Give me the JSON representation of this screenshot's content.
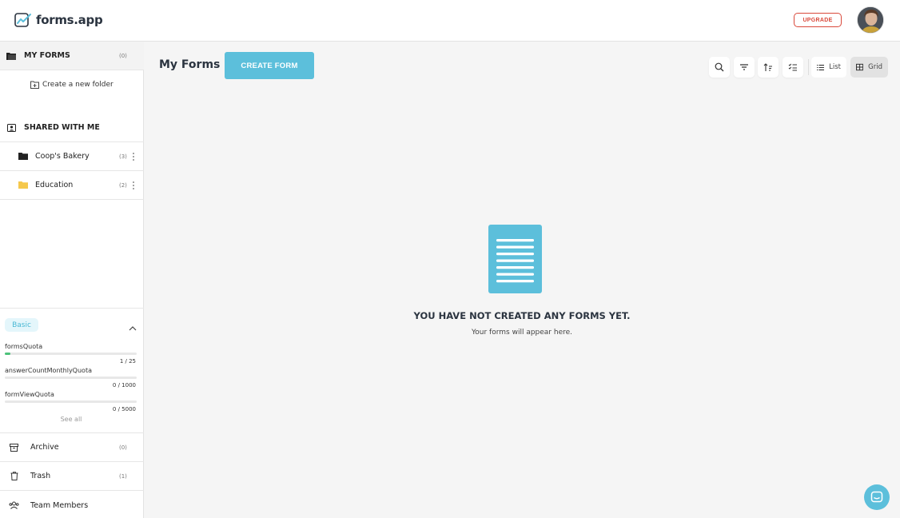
{
  "app": {
    "name": "forms.app"
  },
  "header": {
    "upgrade_label": "UPGRADE"
  },
  "sidebar": {
    "my_forms": {
      "label": "MY FORMS",
      "count": "(0)"
    },
    "create_folder_label": "Create a new folder",
    "shared_with_me": {
      "label": "SHARED WITH ME"
    },
    "folders": [
      {
        "label": "Coop's Bakery",
        "count": "(3)",
        "color": "#222222"
      },
      {
        "label": "Education",
        "count": "(2)",
        "color": "#f5c84c"
      }
    ],
    "plan": {
      "label": "Basic",
      "quotas": [
        {
          "label": "formsQuota",
          "value": "1 / 25",
          "fraction": 0.04
        },
        {
          "label": "answerCountMonthlyQuota",
          "value": "0 / 1000",
          "fraction": 0
        },
        {
          "label": "formViewQuota",
          "value": "0 / 5000",
          "fraction": 0
        }
      ],
      "see_all_label": "See all"
    },
    "bottom_items": [
      {
        "label": "Archive",
        "count": "(0)"
      },
      {
        "label": "Trash",
        "count": "(1)"
      },
      {
        "label": "Team Members",
        "count": ""
      }
    ]
  },
  "main": {
    "title": "My Forms",
    "create_label": "CREATE FORM",
    "view_list_label": "List",
    "view_grid_label": "Grid",
    "empty_title": "YOU HAVE NOT CREATED ANY FORMS YET.",
    "empty_subtitle": "Your forms will appear here."
  },
  "colors": {
    "accent": "#5cbfdb",
    "upgrade": "#d9493b",
    "quota_fill": "#4cc27a"
  }
}
